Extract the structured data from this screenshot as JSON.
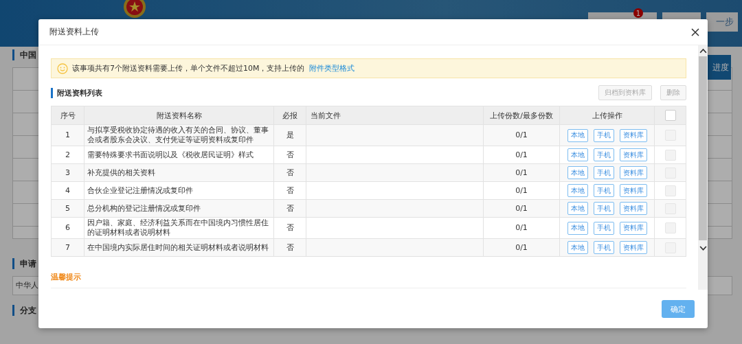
{
  "background": {
    "badge": "1",
    "top_button": "一步",
    "side_button": "进度",
    "sections": [
      "中国",
      "申请",
      "分支"
    ],
    "cell": "中华人"
  },
  "dialog": {
    "title": "附送资料上传",
    "notice": {
      "text": "该事项共有7个附送资料需要上传，单个文件不超过10M，支持上传的",
      "link": "附件类型格式"
    },
    "section_title": "附送资料列表",
    "actions": [
      {
        "label": "归档到资料库",
        "disabled": true
      },
      {
        "label": "删除",
        "disabled": true
      }
    ],
    "table": {
      "columns": [
        "序号",
        "附送资料名称",
        "必报",
        "当前文件",
        "上传份数/最多份数",
        "上传操作"
      ],
      "select_all": {
        "checked": false,
        "disabled": false
      },
      "rows": [
        {
          "no": "1",
          "name": "与拟享受税收协定待遇的收入有关的合同、协议、董事会或者股东会决议、支付凭证等证明资料或复印件",
          "required": "是",
          "count": "0/1",
          "ops": [
            "本地",
            "手机",
            "资料库"
          ],
          "checked": false,
          "disabled": true
        },
        {
          "no": "2",
          "name": "需要特殊要求书面说明以及《税收居民证明》样式",
          "required": "否",
          "count": "0/1",
          "ops": [
            "本地",
            "手机",
            "资料库"
          ],
          "checked": false,
          "disabled": true
        },
        {
          "no": "3",
          "name": "补充提供的相关资料",
          "required": "否",
          "count": "0/1",
          "ops": [
            "本地",
            "手机",
            "资料库"
          ],
          "checked": false,
          "disabled": true
        },
        {
          "no": "4",
          "name": "合伙企业登记注册情况或复印件",
          "required": "否",
          "count": "0/1",
          "ops": [
            "本地",
            "手机",
            "资料库"
          ],
          "checked": false,
          "disabled": true
        },
        {
          "no": "5",
          "name": "总分机构的登记注册情况或复印件",
          "required": "否",
          "count": "0/1",
          "ops": [
            "本地",
            "手机",
            "资料库"
          ],
          "checked": false,
          "disabled": true
        },
        {
          "no": "6",
          "name": "因户籍、家庭、经济利益关系而在中国境内习惯性居住的证明材料或者说明材料",
          "required": "否",
          "count": "0/1",
          "ops": [
            "本地",
            "手机",
            "资料库"
          ],
          "checked": false,
          "disabled": true
        },
        {
          "no": "7",
          "name": "在中国境内实际居住时间的相关证明材料或者说明材料",
          "required": "否",
          "count": "0/1",
          "ops": [
            "本地",
            "手机",
            "资料库"
          ],
          "checked": false,
          "disabled": true
        }
      ]
    },
    "tips_title": "温馨提示",
    "confirm": "确定"
  }
}
